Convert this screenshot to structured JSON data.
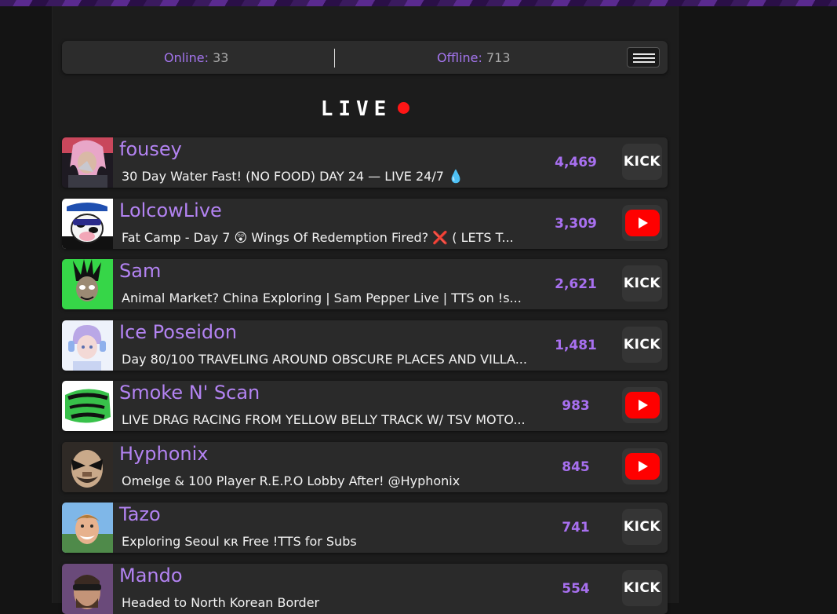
{
  "status": {
    "online_label": "Online:",
    "online_count": "33",
    "offline_label": "Offline:",
    "offline_count": "713"
  },
  "menu_icon": "hamburger-menu-icon",
  "live_heading": "LIVE",
  "colors": {
    "accent": "#b383f2",
    "live_dot": "#ff1616",
    "youtube": "#ff0000",
    "row_bg": "#2a2a2a",
    "page_bg": "#141414"
  },
  "streams": [
    {
      "name": "fousey",
      "title": "30 Day Water Fast! (NO FOOD) DAY 24 — LIVE 24/7 💧",
      "viewers": "4,469",
      "platform": "kick",
      "platform_label": "KICK"
    },
    {
      "name": "LolcowLive",
      "title": "Fat Camp - Day 7 😲 Wings Of Redemption Fired? ❌ ( LETS T...",
      "viewers": "3,309",
      "platform": "youtube",
      "platform_label": ""
    },
    {
      "name": "Sam",
      "title": "Animal Market? China Exploring | Sam Pepper Live | TTS on !s...",
      "viewers": "2,621",
      "platform": "kick",
      "platform_label": "KICK"
    },
    {
      "name": "Ice Poseidon",
      "title": "Day 80/100 TRAVELING AROUND OBSCURE PLACES AND VILLA...",
      "viewers": "1,481",
      "platform": "kick",
      "platform_label": "KICK"
    },
    {
      "name": "Smoke N' Scan",
      "title": "LIVE DRAG RACING FROM YELLOW BELLY TRACK W/ TSV MOTO...",
      "viewers": "983",
      "platform": "youtube",
      "platform_label": ""
    },
    {
      "name": "Hyphonix",
      "title": "Omelge & 100 Player R.E.P.O Lobby After! @Hyphonix",
      "viewers": "845",
      "platform": "youtube",
      "platform_label": ""
    },
    {
      "name": "Tazo",
      "title": "Exploring Seoul ᴋʀ Free !TTS for Subs",
      "viewers": "741",
      "platform": "kick",
      "platform_label": "KICK"
    },
    {
      "name": "Mando",
      "title": "Headed to North Korean Border",
      "viewers": "554",
      "platform": "kick",
      "platform_label": "KICK"
    }
  ]
}
